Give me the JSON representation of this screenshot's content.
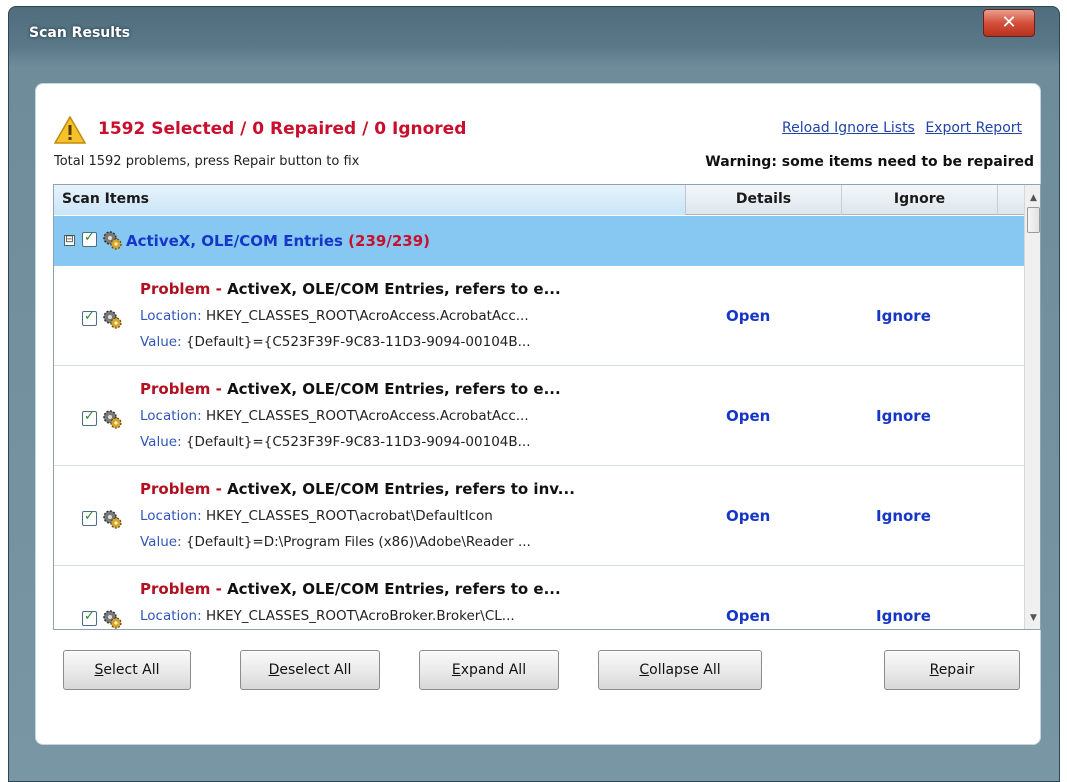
{
  "window": {
    "title": "Scan Results",
    "close_label": "✕"
  },
  "status": {
    "summary": "1592 Selected / 0 Repaired / 0 Ignored",
    "reload_link": "Reload Ignore Lists",
    "export_link": "Export Report",
    "total_text": "Total 1592 problems, press Repair button to fix",
    "warning_text": "Warning: some items need to be repaired"
  },
  "table": {
    "headers": {
      "items": "Scan Items",
      "details": "Details",
      "ignore": "Ignore"
    },
    "group": {
      "title": "ActiveX, OLE/COM Entries",
      "count": "(239/239)",
      "expander": "⊟"
    },
    "problem_label": "Problem",
    "location_label": "Location:",
    "value_label": "Value:",
    "rows": [
      {
        "problem": "ActiveX, OLE/COM Entries, refers to e...",
        "location": "HKEY_CLASSES_ROOT\\AcroAccess.AcrobatAcc...",
        "value": "{Default}={C523F39F-9C83-11D3-9094-00104B...",
        "open": "Open",
        "ignore": "Ignore"
      },
      {
        "problem": "ActiveX, OLE/COM Entries, refers to e...",
        "location": "HKEY_CLASSES_ROOT\\AcroAccess.AcrobatAcc...",
        "value": "{Default}={C523F39F-9C83-11D3-9094-00104B...",
        "open": "Open",
        "ignore": "Ignore"
      },
      {
        "problem": "ActiveX, OLE/COM Entries, refers to inv...",
        "location": "HKEY_CLASSES_ROOT\\acrobat\\DefaultIcon",
        "value": "{Default}=D:\\Program Files (x86)\\Adobe\\Reader ...",
        "open": "Open",
        "ignore": "Ignore"
      },
      {
        "problem": "ActiveX, OLE/COM Entries, refers to e...",
        "location": "HKEY_CLASSES_ROOT\\AcroBroker.Broker\\CL...",
        "value": "",
        "open": "Open",
        "ignore": "Ignore"
      }
    ]
  },
  "buttons": {
    "select_all": {
      "first": "S",
      "rest": "elect All"
    },
    "deselect_all": {
      "first": "D",
      "rest": "eselect All"
    },
    "expand_all": {
      "first": "E",
      "rest": "xpand All"
    },
    "collapse_all": {
      "first": "C",
      "rest": "ollapse All"
    },
    "repair": {
      "first": "R",
      "rest": "epair"
    }
  },
  "colors": {
    "accent_red": "#c8102e",
    "link_blue": "#1636c8",
    "group_bg": "#86c8f1"
  }
}
